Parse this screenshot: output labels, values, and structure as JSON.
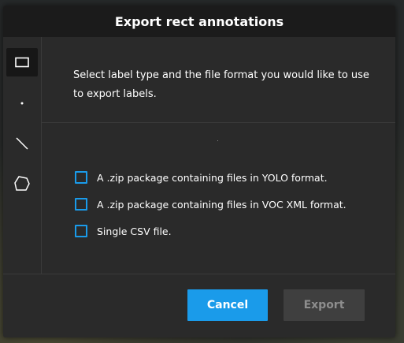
{
  "dialog": {
    "title": "Export rect annotations",
    "instructions": "Select label type and the file format you would like to use to export labels.",
    "options": [
      {
        "label": "A .zip package containing files in YOLO format.",
        "checked": false
      },
      {
        "label": "A .zip package containing files in VOC XML format.",
        "checked": false
      },
      {
        "label": "Single CSV file.",
        "checked": false
      }
    ],
    "buttons": {
      "cancel_label": "Cancel",
      "export_label": "Export"
    }
  },
  "sidebar": {
    "tools": [
      {
        "icon": "rectangle-icon",
        "active": true
      },
      {
        "icon": "point-icon",
        "active": false
      },
      {
        "icon": "line-icon",
        "active": false
      },
      {
        "icon": "polygon-icon",
        "active": false
      }
    ]
  },
  "colors": {
    "accent": "#1a9bea",
    "header_bg": "#1b1b1b",
    "dialog_bg": "#2a2a2a",
    "disabled_button_bg": "#3f3f3f"
  }
}
